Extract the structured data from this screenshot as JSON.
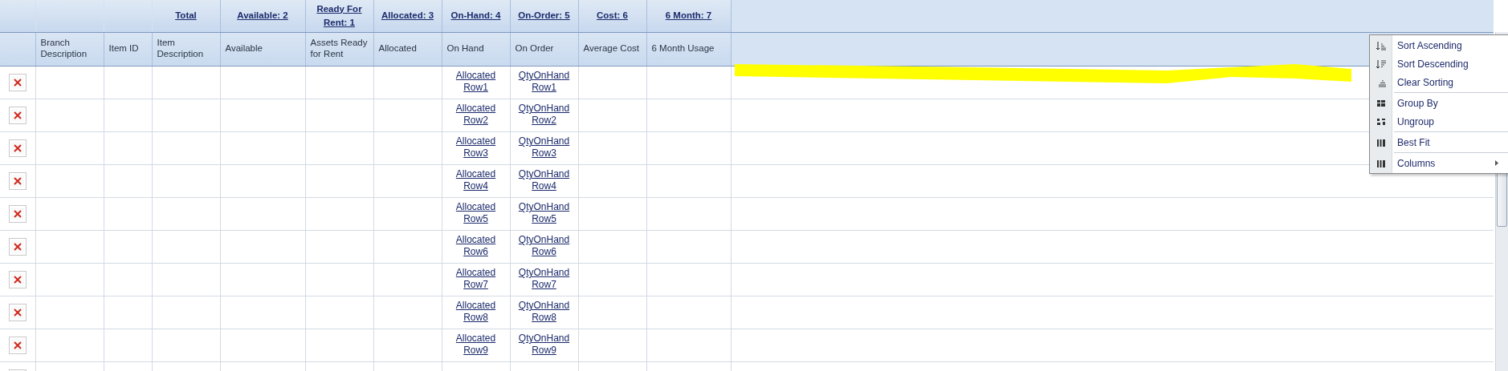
{
  "columns": [
    {},
    {
      "title": "Branch Description"
    },
    {
      "title": "Item ID"
    },
    {
      "summary": "Total",
      "title": "Item Description"
    },
    {
      "summary": "Available: 2",
      "title": "Available"
    },
    {
      "summary": "Ready For Rent: 1",
      "title": "Assets Ready for Rent"
    },
    {
      "summary": "Allocated: 3",
      "title": "Allocated"
    },
    {
      "summary": "On-Hand: 4",
      "title": "On Hand"
    },
    {
      "summary": "On-Order: 5",
      "title": "On Order"
    },
    {
      "summary": "Cost: 6",
      "title": "Average Cost"
    },
    {
      "summary": "6 Month: 7",
      "title": "6 Month Usage"
    }
  ],
  "rows": [
    {
      "on_hand": "Allocated Row1",
      "on_order": "QtyOnHand Row1"
    },
    {
      "on_hand": "Allocated Row2",
      "on_order": "QtyOnHand Row2"
    },
    {
      "on_hand": "Allocated Row3",
      "on_order": "QtyOnHand Row3"
    },
    {
      "on_hand": "Allocated Row4",
      "on_order": "QtyOnHand Row4"
    },
    {
      "on_hand": "Allocated Row5",
      "on_order": "QtyOnHand Row5"
    },
    {
      "on_hand": "Allocated Row6",
      "on_order": "QtyOnHand Row6"
    },
    {
      "on_hand": "Allocated Row7",
      "on_order": "QtyOnHand Row7"
    },
    {
      "on_hand": "Allocated Row8",
      "on_order": "QtyOnHand Row8"
    },
    {
      "on_hand": "Allocated Row9",
      "on_order": "QtyOnHand Row9"
    }
  ],
  "context_menu": {
    "groups": [
      [
        {
          "label": "Sort Ascending",
          "kind": "sort-ascending"
        },
        {
          "label": "Sort Descending",
          "kind": "sort-descending"
        },
        {
          "label": "Clear Sorting",
          "kind": "clear-sorting"
        }
      ],
      [
        {
          "label": "Group By",
          "kind": "group"
        },
        {
          "label": "Ungroup",
          "kind": "ungroup"
        }
      ],
      [
        {
          "label": "Best Fit",
          "kind": "columns"
        }
      ],
      [
        {
          "label": "Columns",
          "kind": "columns",
          "submenu": true
        }
      ]
    ]
  }
}
